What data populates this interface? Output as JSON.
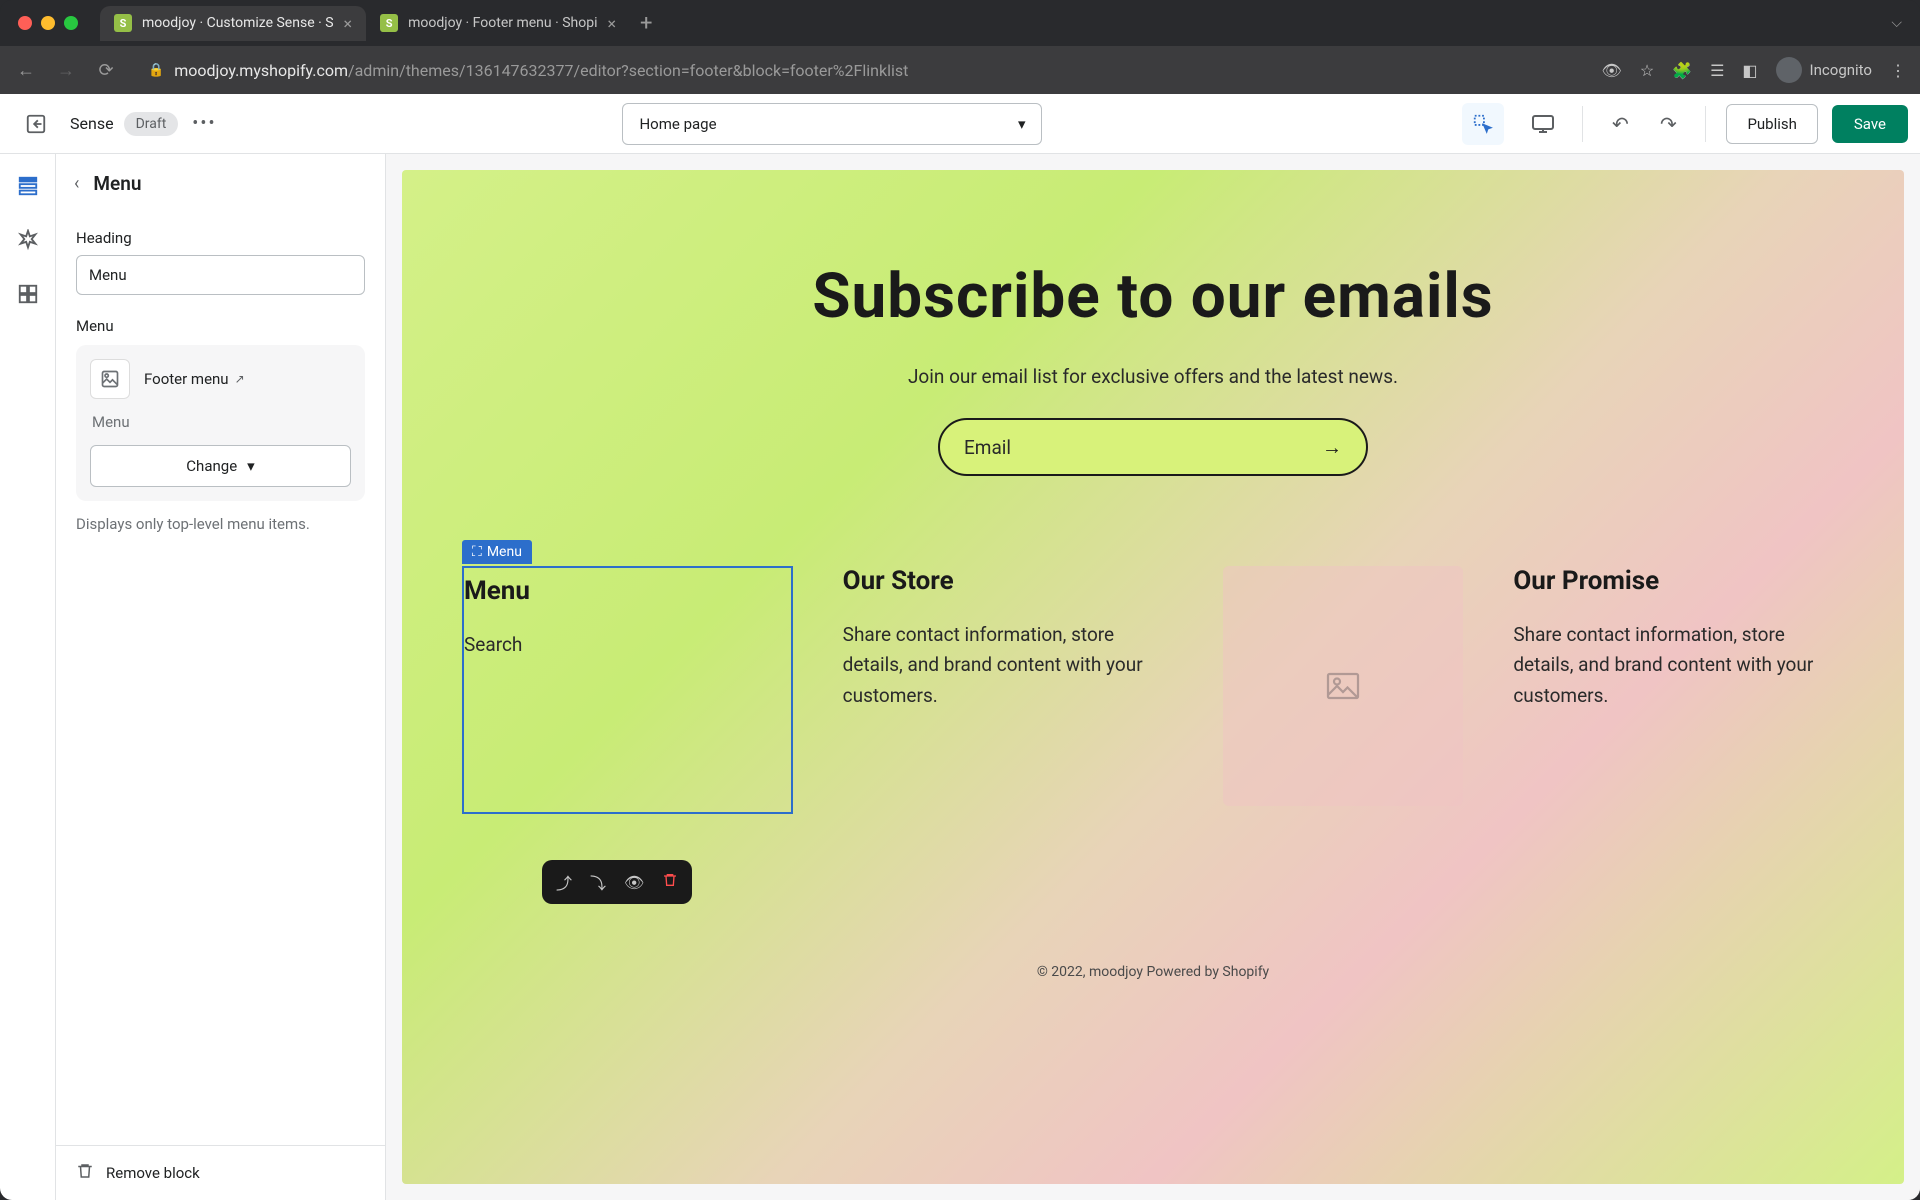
{
  "browser": {
    "tabs": [
      {
        "title": "moodjoy · Customize Sense · S",
        "active": true
      },
      {
        "title": "moodjoy · Footer menu · Shopi",
        "active": false
      }
    ],
    "url_host": "moodjoy.myshopify.com",
    "url_path": "/admin/themes/136147632377/editor?section=footer&block=footer%2Flinklist",
    "incognito_label": "Incognito"
  },
  "header": {
    "theme_name": "Sense",
    "status_badge": "Draft",
    "page_selector": "Home page",
    "publish_label": "Publish",
    "save_label": "Save"
  },
  "sidebar": {
    "title": "Menu",
    "heading_label": "Heading",
    "heading_value": "Menu",
    "menu_label": "Menu",
    "menu_link_text": "Footer menu",
    "menu_sub": "Menu",
    "change_label": "Change",
    "help_text": "Displays only top-level menu items.",
    "remove_label": "Remove block"
  },
  "preview": {
    "hero_title": "Subscribe to our emails",
    "hero_sub": "Join our email list for exclusive offers and the latest news.",
    "email_placeholder": "Email",
    "block_tag": "Menu",
    "cols": {
      "menu": {
        "title": "Menu",
        "link1": "Search"
      },
      "store": {
        "title": "Our Store",
        "text": "Share contact information, store details, and brand content with your customers."
      },
      "promise": {
        "title": "Our Promise",
        "text": "Share contact information, store details, and brand content with your customers."
      }
    },
    "copyright": "© 2022, moodjoy Powered by Shopify"
  }
}
